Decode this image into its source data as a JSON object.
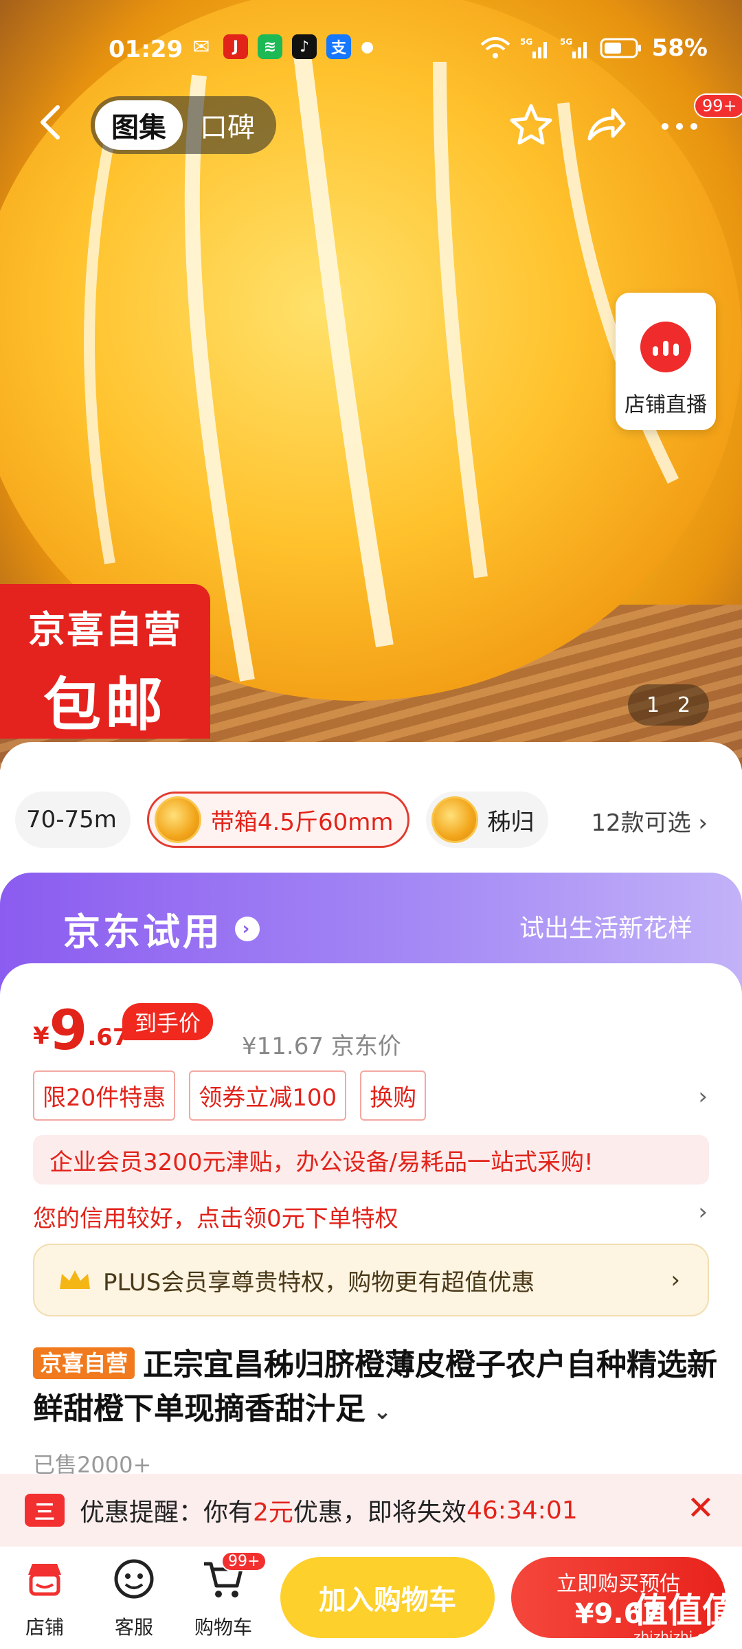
{
  "status_bar": {
    "time": "01:29",
    "battery": "58%",
    "app_icons": [
      "wechat-icon",
      "jd-icon",
      "spotify-icon",
      "tiktok-icon",
      "alipay-icon"
    ]
  },
  "nav": {
    "tab_gallery": "图集",
    "tab_reviews": "口碑",
    "badge": "99+"
  },
  "live": {
    "label": "店铺直播"
  },
  "promo_tag": {
    "line1": "京喜自营",
    "line2": "包邮"
  },
  "pager": {
    "current": "1",
    "total": "2"
  },
  "sku": {
    "items": [
      {
        "label": "70-75m",
        "active": false
      },
      {
        "label": "带箱4.5斤60mm",
        "active": true
      },
      {
        "label": "秭归",
        "active": false
      }
    ],
    "more": "12款可选"
  },
  "trial": {
    "title": "京东试用",
    "slogan": "试出生活新花样"
  },
  "price": {
    "currency": "¥",
    "integer": "9",
    "decimal": ".67",
    "tag": "到手价",
    "original": "¥11.67 京东价"
  },
  "promos": [
    "限20件特惠",
    "领券立减100",
    "换购"
  ],
  "corp_banner": "企业会员3200元津贴，办公设备/易耗品一站式采购!",
  "credit_text": "您的信用较好，点击领0元下单特权",
  "plus_text": "PLUS会员享尊贵特权，购物更有超值优惠",
  "product": {
    "badge": "京喜自营",
    "title": "正宗宜昌秭归脐橙薄皮橙子农户自种精选新鲜甜橙下单现摘香甜汁足",
    "sold": "已售2000+"
  },
  "reminder": {
    "prefix": "优惠提醒：你有",
    "amount": "2元",
    "middle": "优惠，即将失效",
    "countdown": "46:34:01"
  },
  "bottom_bar": {
    "store": "店铺",
    "service": "客服",
    "cart": "购物车",
    "cart_badge": "99+",
    "add_cart": "加入购物车",
    "buy_line1": "立即购买预估",
    "buy_line2": "¥9.67"
  },
  "watermark": {
    "brand": "值值值",
    "site": "zhizhizhi.com"
  },
  "colors": {
    "accent_red": "#e2231a",
    "cart_yellow": "#fdd02b",
    "trial_purple": "#8b5cf0",
    "self_orange": "#f07a1d"
  }
}
